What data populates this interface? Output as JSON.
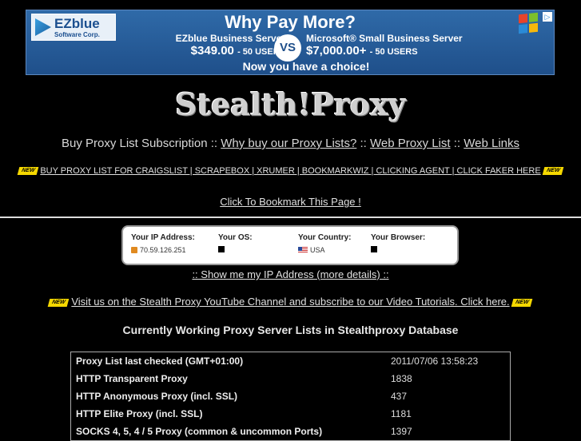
{
  "banner": {
    "brand": "EZblue",
    "brand_sub": "Software Corp.",
    "headline": "Why Pay More?",
    "left_product": "EZblue Business Server",
    "left_price": "$349.00",
    "left_users": "- 50 USERS",
    "vs": "VS",
    "right_product": "Microsoft® Small Business Server",
    "right_price": "$7,000.00+",
    "right_users": "- 50 USERS",
    "cta": "Now you have a choice!",
    "adchoice": "▷"
  },
  "site": {
    "logo": "Stealth!Proxy"
  },
  "nav": {
    "lead": "Buy Proxy List Subscription",
    "sep": " :: ",
    "link1": "Why buy our Proxy Lists?",
    "link2": "Web Proxy List",
    "link3": "Web Links"
  },
  "promo": {
    "badge": "NEW",
    "text": "BUY PROXY LIST FOR CRAIGSLIST | SCRAPEBOX | XRUMER | BOOKMARKWIZ | CLICKING AGENT | CLICK FAKER HERE"
  },
  "bookmark": "Click To Bookmark This Page !",
  "ip_panel": {
    "ip_label": "Your IP Address:",
    "ip_value": "70.59.126.251",
    "os_label": "Your OS:",
    "country_label": "Your Country:",
    "country_value": "USA",
    "browser_label": "Your Browser:"
  },
  "more_ip": ":: Show me my IP Address (more details) ::",
  "youtube": "Visit us on the Stealth Proxy YouTube Channel and subscribe to our Video Tutorials. Click here.",
  "section_title": "Currently Working Proxy Server Lists in Stealthproxy Database",
  "stats": [
    {
      "label": "Proxy List last checked (GMT+01:00)",
      "value": "2011/07/06 13:58:23"
    },
    {
      "label": "HTTP Transparent Proxy",
      "value": "1838"
    },
    {
      "label": "HTTP Anonymous Proxy (incl. SSL)",
      "value": "437"
    },
    {
      "label": "HTTP Elite Proxy (incl. SSL)",
      "value": "1181"
    },
    {
      "label": "SOCKS 4, 5, 4 / 5 Proxy (common & uncommon Ports)",
      "value": "1397"
    }
  ],
  "colors": {
    "background": "#000000",
    "banner": "#2f6aa8",
    "badge": "#f5d800"
  }
}
